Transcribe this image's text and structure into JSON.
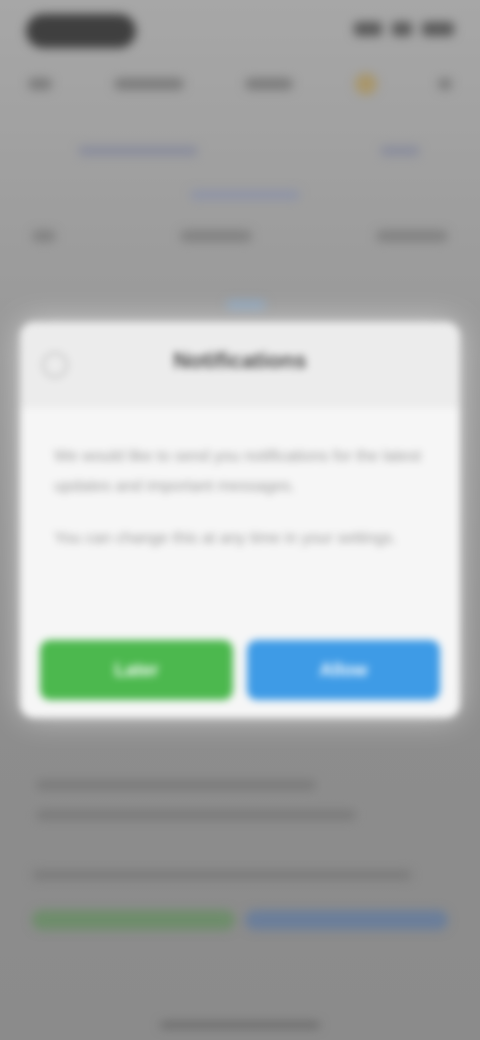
{
  "dialog": {
    "title": "Notifications",
    "body": [
      "We would like to send you notifications for the latest updates and important messages.",
      "You can change this at any time in your settings."
    ],
    "buttons": {
      "left_label": "Later",
      "right_label": "Allow"
    }
  },
  "colors": {
    "primary_green": "#4cb84e",
    "primary_blue": "#3e9be6",
    "dialog_background": "#f6f6f6",
    "overlay": "#8d8d8d"
  },
  "icons": {
    "close": "close-icon"
  }
}
